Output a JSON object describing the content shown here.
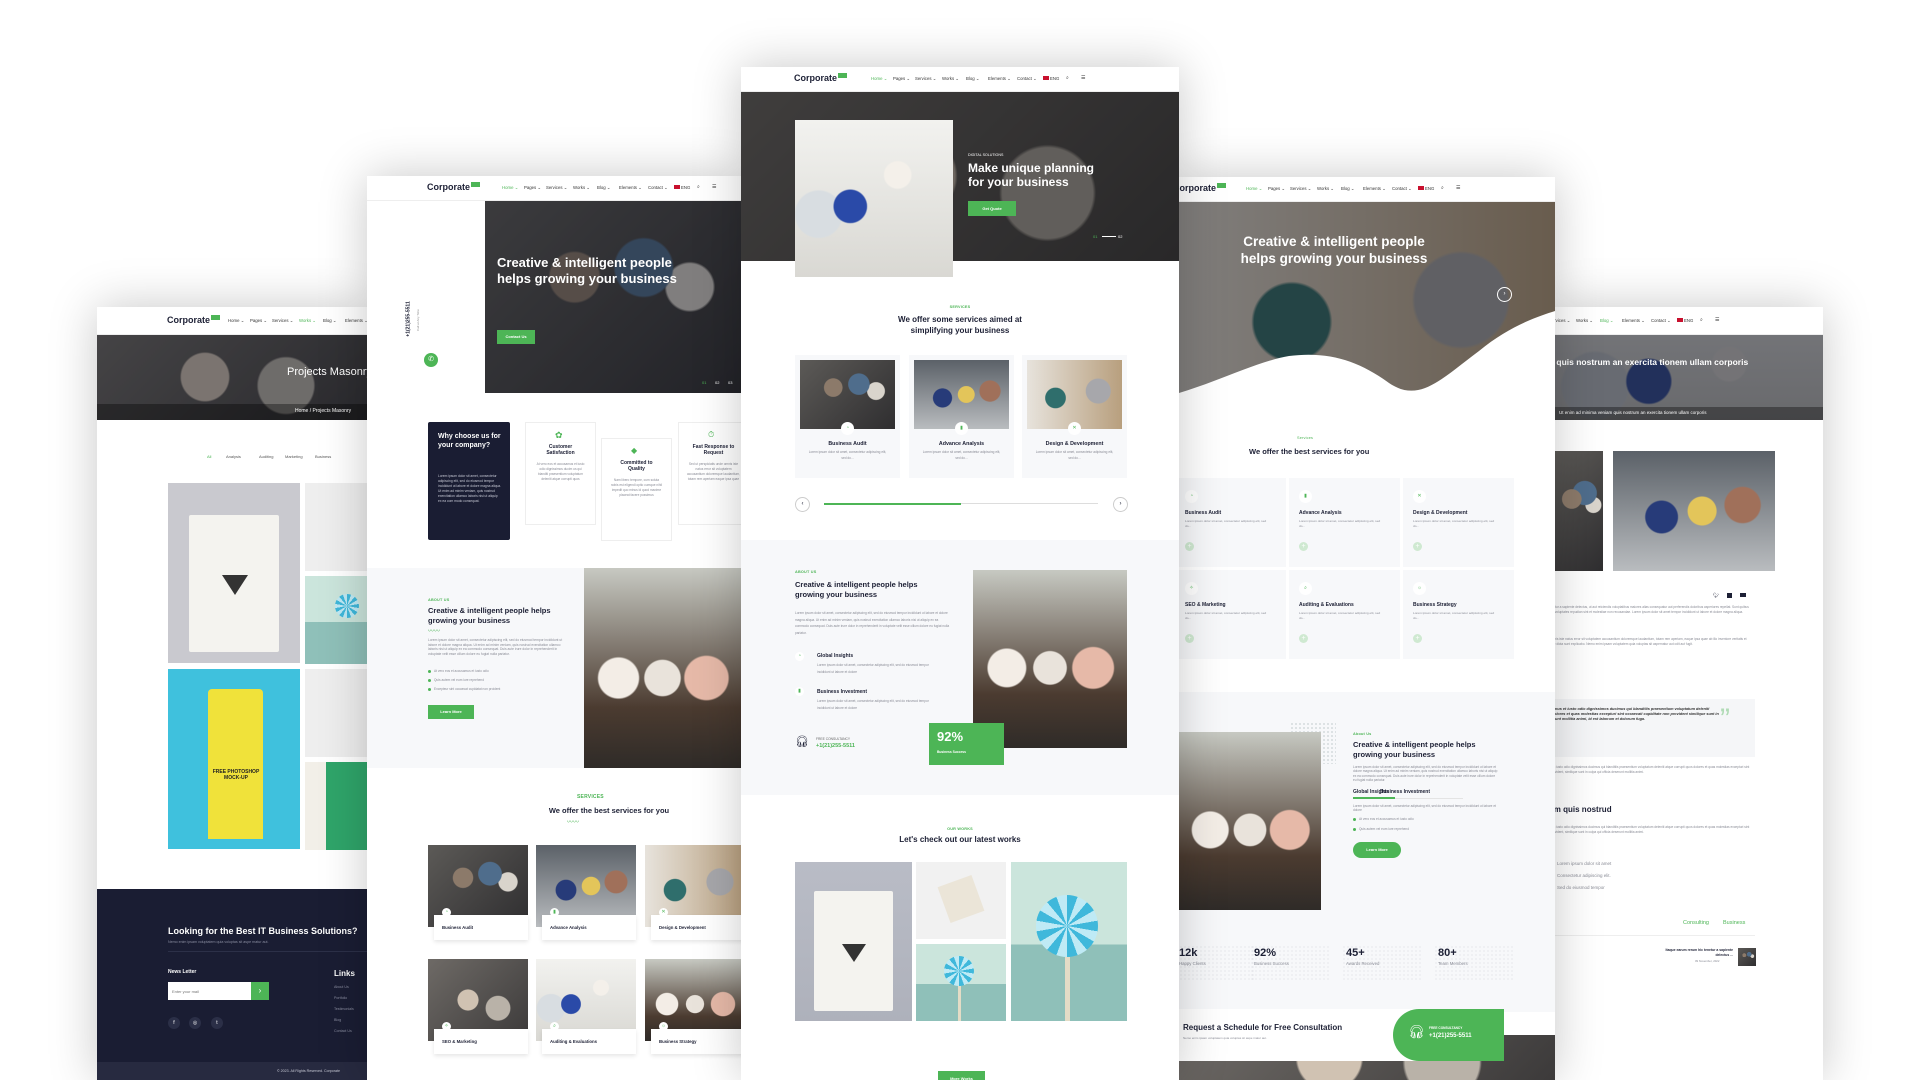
{
  "brand": {
    "logo": "Corporate",
    "accent": "#4db556",
    "dark": "#1a1d33"
  },
  "nav": {
    "items": [
      "Home",
      "Pages",
      "Services",
      "Works",
      "Blog",
      "Elements",
      "Contact"
    ],
    "lang": "ENG"
  },
  "lorem": {
    "short": "Lorem ipsum dolor sit amet, consectetur adipiscing elit, sed do...",
    "line": "Lorem ipsum dolor sit amet, consectetur adipiscing elit, sed do eiusmod tempor incididunt ut labore et dolore",
    "para": "Lorem ipsum dolor sit amet, consectetur adipiscing elit, sed do eiusmod tempor incididunt ut labore et dolore magna aliqua. Ut enim ad minim veniam, quis nostrud exercitation ullamco laboris nisi ut aliquip ex ea commodo consequat. Duis aute irure dolor in reprehenderit in voluptate velit esse cillum dolore eu fugiat nulla pariatur."
  },
  "masonry": {
    "title": "Projects Masonry",
    "breadcrumb": "Home / Projects Masonry",
    "filters": [
      "All",
      "Analysis",
      "Auditing",
      "Marketing",
      "Business"
    ],
    "mockup_text": "FREE PHOTOSHOP MOCK-UP",
    "footer": {
      "title": "Looking for the Best IT Business Solutions?",
      "subtitle": "Nemo enim ipsam voluptatem quia voluptas sit aspe rnatur aut.",
      "newsletter": "News Letter",
      "email_placeholder": "Enter your mail",
      "links_title": "Links",
      "links": [
        "About Us",
        "Portfolio",
        "Testimonials",
        "Blog",
        "Contact Us"
      ],
      "copyright": "© 2023. All Rights Reserved. Corporate"
    }
  },
  "home2": {
    "phone": "+1(21)255-5511",
    "call": "Call at Any Time",
    "hero_title": "Creative & intelligent people helps growing your business",
    "hero_button": "Contact Us",
    "slides": [
      "01",
      "02",
      "03"
    ],
    "why": {
      "title": "Why choose us for your company?",
      "text": "Lorem ipsum dolor sit amet, consectetur adipiscing elit, sed do eiusmod tempor incididunt ut labore et dolore magna aliqua. Ut enim ad minim veniam, quis nostrud exercitation ullamco laboris nisi ut aliquip ex ea com modo consequat."
    },
    "features": [
      {
        "title": "Customer Satisfaction",
        "text": "At vero eos et accusamus et iusto odio dignissimos ducim us qui blanditi praesentium voluptatum deleniti atque corrupti quos"
      },
      {
        "title": "Committed to Quality",
        "text": "Nam libero tempore, cum soluta nobis est eligendi optio cumque nihil impedit quo minus id quod maxime placeat facere possimus"
      },
      {
        "title": "Fast Response to Request",
        "text": "Sed ut perspiciatis unde omnis iste natus error sit voluptatem accusantium doloremque laudantium, totam rem aperiam eaque ipsa quae"
      }
    ],
    "about": {
      "label": "ABOUT US",
      "title": "Creative & intelligent people helps growing your business",
      "bullets": [
        "At vero eos et accusamus et iusto odio",
        "Quis autem vel eum iure reprehend",
        "Excepteur sint occaecat cupidatat non proident"
      ],
      "button": "Learn More"
    },
    "services": {
      "label": "SERVICES",
      "title": "We offer the best services for you",
      "items": [
        "Business Audit",
        "Advance Analysis",
        "Design & Development",
        "SEO & Marketing",
        "Auditing & Evaluations",
        "Business Strategy"
      ]
    }
  },
  "home1": {
    "hero_label": "DIGITAL SOLUTIONS",
    "hero_title": "Make unique planning for your business",
    "hero_button": "Get Quote",
    "slides": [
      "01",
      "02"
    ],
    "services": {
      "label": "SERVICES",
      "title": "We offer some services aimed at simplifying your business",
      "items": [
        "Business Audit",
        "Advance Analysis",
        "Design & Development"
      ],
      "carousel_progress": 0.5
    },
    "about": {
      "label": "ABOUT US",
      "title": "Creative & intelligent people helps growing your business",
      "features": [
        "Global Insights",
        "Business Investment"
      ],
      "consult_label": "FREE CONSULTANCY",
      "phone": "+1(21)255-5511",
      "stat_value": "92%",
      "stat_label": "Business Success"
    },
    "works": {
      "label": "OUR WORKS",
      "title": "Let's check out our latest works",
      "button": "More Works"
    }
  },
  "home3": {
    "hero_title": "Creative & intelligent people helps growing your business",
    "services": {
      "label": "Services",
      "title": "We offer the best services for you",
      "items": [
        "Business Audit",
        "Advance Analysis",
        "Design & Development",
        "SEO & Marketing",
        "Auditing & Evaluations",
        "Business Strategy"
      ]
    },
    "about": {
      "label": "About Us",
      "title": "Creative & intelligent people helps growing your business",
      "tabs": [
        "Global Insights",
        "Business Investment"
      ],
      "active_tab": 0,
      "bullets": [
        "At vero eos et accusamus et iusto odio",
        "Quis autem vel eum iure reprehend"
      ],
      "button": "Learn More"
    },
    "stats": [
      {
        "value": "12k",
        "label": "Happy Clients"
      },
      {
        "value": "92%",
        "label": "Business Success"
      },
      {
        "value": "45+",
        "label": "Awards Received"
      },
      {
        "value": "80+",
        "label": "Team Members"
      }
    ],
    "cta": {
      "title": "Request a Schedule for Free Consultation",
      "subtitle": "Nemo enim ipsam voluptatem quia voluptas sit aspe rnatur aut.",
      "label": "FREE CONSULTANCY",
      "phone": "+1(21)255-5511"
    }
  },
  "blog": {
    "title": "Ut enim ad minima veniam quis nostrum an exercita tionem ullam corporis",
    "subtitle": "Ut enim ad minima veniam quis nostrum an exercita tionem ullam corporis",
    "para1": "Itaque earum rerum hic tenetur a sapiente delectus, ut aut reiciendis voluptatibus maiores alias consequatur aut perferendis doloribus asperiores repellat. Sunt quibus harum quaepe eveniet ut et voluptates repudian sint et molestiae non recusandae. Lorem ipsum dolor sit amet tempor incididunt ut labore et dolore magna aliqua.",
    "para2": "Sed ut perspiciatis unde omnis iste natus error sit voluptatem accusantium doloremque laudantium, totam rem aperiam, eaque ipsa quae ab illo inventore veritatis et quasi architecto beatae vitae dicta sunt explicabo. Nemo enim ipsam voluptatem quia voluptas sit aspernatur aut odit aut fugit.",
    "quote": "At vero eos et accusamus et iusto odio dignissimos ducimus qui blanditiis praesentium voluptatum deleniti atque corrupti quos dolores et quas molestias excepturi sint occaecati cupiditate non provident similique sunt in culpa qui officia deserunt mollitia animi, id est laborum et dolorum fuga.",
    "para3": "At vero eos et accusamus et iusto odio dignissimos ducimus qui blanditiis praesentium voluptatum deleniti atque corrupti quos dolores et quas molestias excepturi sint occaecati cupiditate non provident, similique sunt in culpa qui officia deserunt mollitia animi.",
    "heading": "Ut enim ad minima veniam quis nostrud",
    "list": [
      "Lorem ipsum dolor sit amet",
      "Consectetur adipiscing elit.",
      "Sed do eiusmod tempor"
    ],
    "tags": [
      "Consulting",
      "Business"
    ],
    "recent_title": "Itaque earum rerum hic tenetur a sapiente delectus ...",
    "recent_date": "09 November, 2022"
  }
}
